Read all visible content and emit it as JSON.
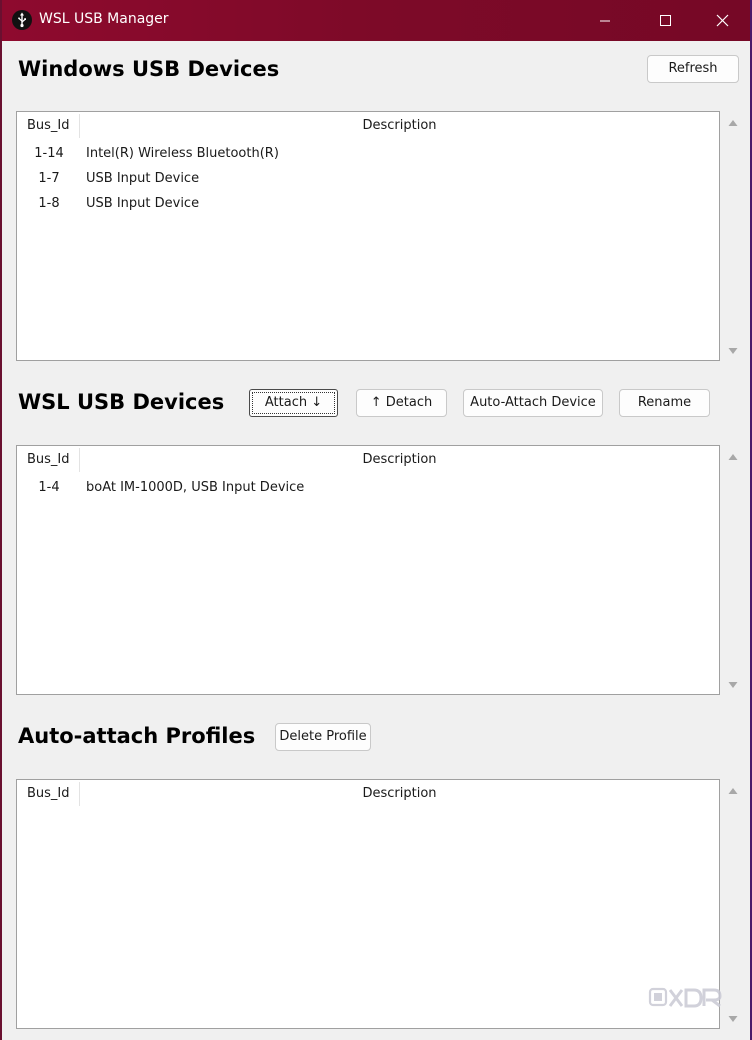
{
  "window": {
    "title": "WSL USB Manager"
  },
  "windows_usb": {
    "title": "Windows USB Devices",
    "refresh_label": "Refresh",
    "columns": [
      "Bus_Id",
      "Description"
    ],
    "rows": [
      {
        "bus_id": "1-14",
        "description": "Intel(R) Wireless Bluetooth(R)"
      },
      {
        "bus_id": "1-7",
        "description": "USB Input Device"
      },
      {
        "bus_id": "1-8",
        "description": "USB Input Device"
      }
    ]
  },
  "wsl_usb": {
    "title": "WSL USB Devices",
    "attach_label": "Attach ↓",
    "detach_label": "↑ Detach",
    "auto_attach_label": "Auto-Attach Device",
    "rename_label": "Rename",
    "columns": [
      "Bus_Id",
      "Description"
    ],
    "rows": [
      {
        "bus_id": "1-4",
        "description": "boAt IM-1000D, USB Input Device"
      }
    ]
  },
  "auto_attach": {
    "title": "Auto-attach Profiles",
    "delete_label": "Delete Profile",
    "columns": [
      "Bus_Id",
      "Description"
    ],
    "rows": []
  },
  "watermark": {
    "text": "XDA"
  },
  "icons": {
    "app": "usb-icon",
    "minimize": "minimize-icon",
    "maximize": "maximize-icon",
    "close": "close-icon",
    "scroll_up": "chevron-up-icon",
    "scroll_down": "chevron-down-icon"
  },
  "colors": {
    "titlebar": "#8e0a2e",
    "window_bg": "#f0f0f0",
    "list_bg": "#ffffff"
  }
}
